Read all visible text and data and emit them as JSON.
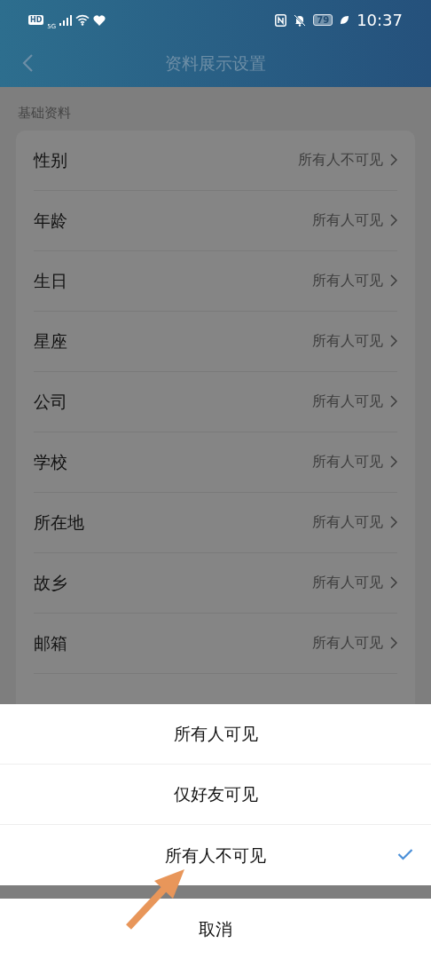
{
  "status_bar": {
    "hd_badge": "HD",
    "network": "5G",
    "battery": "79",
    "time": "10:37"
  },
  "header": {
    "title": "资料展示设置"
  },
  "section": {
    "title": "基础资料",
    "rows": [
      {
        "label": "性别",
        "value": "所有人不可见"
      },
      {
        "label": "年龄",
        "value": "所有人可见"
      },
      {
        "label": "生日",
        "value": "所有人可见"
      },
      {
        "label": "星座",
        "value": "所有人可见"
      },
      {
        "label": "公司",
        "value": "所有人可见"
      },
      {
        "label": "学校",
        "value": "所有人可见"
      },
      {
        "label": "所在地",
        "value": "所有人可见"
      },
      {
        "label": "故乡",
        "value": "所有人可见"
      },
      {
        "label": "邮箱",
        "value": "所有人可见"
      }
    ]
  },
  "sheet": {
    "options": [
      {
        "label": "所有人可见",
        "selected": false
      },
      {
        "label": "仅好友可见",
        "selected": false
      },
      {
        "label": "所有人不可见",
        "selected": true
      }
    ],
    "cancel": "取消"
  },
  "annotation": {
    "kind": "arrow"
  }
}
